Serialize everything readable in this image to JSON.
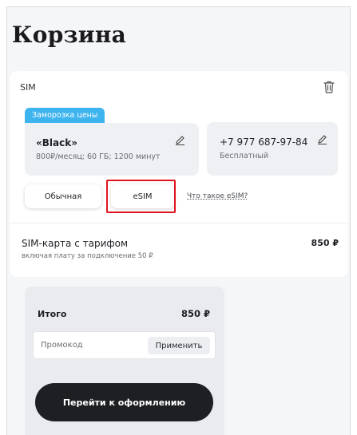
{
  "page": {
    "title": "Корзина"
  },
  "cart_item": {
    "type_label": "SIM",
    "badge": "Заморозка цены",
    "tariff": {
      "name": "«Black»",
      "details": "800₽/месяц; 60 ГБ; 1200 минут"
    },
    "phone": {
      "number": "+7 977 687-97-84",
      "status": "Бесплатный"
    },
    "sim_options": {
      "regular_label": "Обычная",
      "esim_label": "eSIM",
      "selected": "eSIM",
      "info_link": "Что такое eSIM?"
    },
    "line": {
      "name": "SIM-карта с тарифом",
      "price": "850 ₽",
      "subtext": "включая плату за подключение   50 ₽"
    }
  },
  "summary": {
    "total_label": "Итого",
    "total_value": "850 ₽",
    "promo_placeholder": "Промокод",
    "apply_label": "Применить",
    "checkout_label": "Перейти к оформлению"
  },
  "colors": {
    "accent_badge": "#3eb4ee",
    "highlight": "#e0141e",
    "checkout_button": "#1e1f23"
  },
  "icons": {
    "delete": "trash-icon",
    "edit": "pencil-icon"
  }
}
